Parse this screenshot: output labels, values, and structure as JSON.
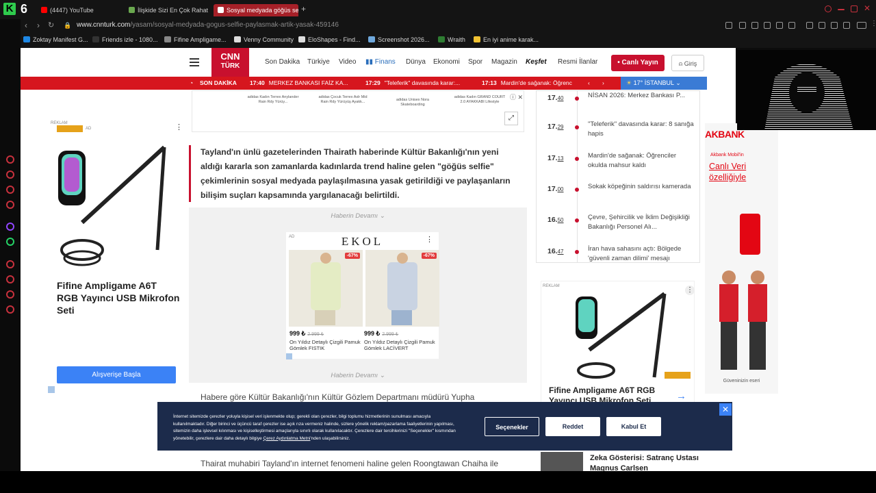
{
  "browser": {
    "tabs": [
      {
        "label": "(4447) YouTube",
        "color": "#ff0000"
      },
      {
        "label": "İlişkide Sizi En Çok Rahatsı",
        "color": "#6aa84f"
      },
      {
        "label": "Sosyal medyada göğüs se",
        "color": "#e06666"
      }
    ],
    "url_host": "www.cnnturk.com",
    "url_path": "/yasam/sosyal-medyada-gogus-selfie-paylasmak-artik-yasak-459146",
    "bookmarks": [
      "Zoktay Manifest G...",
      "Friends izle - 1080...",
      "Fifine Ampligame...",
      "Venny Community",
      "EloShapes - Find...",
      "Screenshot 2026...",
      "Wraith",
      "En iyi anime karak..."
    ]
  },
  "header": {
    "logo_line1": "CNN",
    "logo_line2": "TÜRK",
    "nav": [
      "Son Dakika",
      "Türkiye",
      "Video",
      "Finans",
      "Dünya",
      "Ekonomi",
      "Spor",
      "Magazin",
      "Keşfet",
      "Resmi İlanlar"
    ],
    "live_label": "Canlı Yayın",
    "login_label": "Giriş"
  },
  "ticker": {
    "label": "SON DAKİKA",
    "items": [
      {
        "time": "17:40",
        "text": "MERKEZ BANKASI FAİZ KA..."
      },
      {
        "time": "17:29",
        "text": "\"Teleferik\" davasında karar:..."
      },
      {
        "time": "17:13",
        "text": "Mardin'de sağanak: Öğrenc"
      }
    ],
    "weather": "17° İSTANBUL"
  },
  "top_ads": [
    "adidas Kadın Terrex Anylander Rain Rdy Yürüy...",
    "adidas Çocuk Terrex Axlr Mid Rain Rdy Yürüyüş Ayakk...",
    "adidas Unisex Nora Skateboarding",
    "adidas Kadın GRAND COURT 2.0 AYAKKABI Lifestyle"
  ],
  "article": {
    "lead": "Tayland'ın ünlü gazetelerinden Thairath haberinde Kültür Bakanlığı'nın yeni aldığı kararla son zamanlarda kadınlarda trend haline gelen \"göğüs selfie\" çekimlerinin sosyal medyada paylaşılmasına yasak getirildiği ve paylaşanların bilişim suçları kapsamında yargılanacağı belirtildi.",
    "continue": "Haberin Devamı",
    "para1": "Habere göre Kültür Bakanlığı'nın Kültür Gözlem Departmanı müdürü Yupha",
    "para2": "Thairat muhabiri Tayland'ın internet fenomeni haline gelen Roongtawan Chaiha ile"
  },
  "ekol_ad": {
    "brand": "EKOL",
    "ad_tag": "AD",
    "products": [
      {
        "discount": "-67%",
        "price": "999 ₺",
        "old": "2.999 ₺",
        "name": "On Yıldız Detaylı Çizgili Pamuk Gömlek FISTIK"
      },
      {
        "discount": "-67%",
        "price": "999 ₺",
        "old": "2.999 ₺",
        "name": "On Yıldız Detaylı Çizgili Pamuk Gömlek LACİVERT"
      }
    ]
  },
  "left_ad": {
    "title": "Fifine Ampligame A6T RGB Yayıncı USB Mikrofon Seti",
    "button": "Alışverişe Başla",
    "tag": "AD",
    "reklam": "REKLAM"
  },
  "news_list": [
    {
      "hour": "17.",
      "min": "40",
      "title": "NİSAN 2026: Merkez Bankası P..."
    },
    {
      "hour": "17.",
      "min": "29",
      "title": "\"Teleferik\" davasında karar: 8 sanığa hapis"
    },
    {
      "hour": "17.",
      "min": "13",
      "title": "Mardin'de sağanak: Öğrenciler okulda mahsur kaldı"
    },
    {
      "hour": "17.",
      "min": "00",
      "title": "Sokak köpeğinin saldırısı kamerada"
    },
    {
      "hour": "16.",
      "min": "50",
      "title": "Çevre, Şehircilik ve İklim Değişikliği Bakanlığı Personel Alı..."
    },
    {
      "hour": "16.",
      "min": "47",
      "title": "İran hava sahasını açtı: Bölgede 'güvenli zaman dilimi' mesajı"
    }
  ],
  "right_ad": {
    "title": "Fifine Ampligame A6T RGB Yayıncı USB Mikrofon Seti",
    "reklam": "REKLAM"
  },
  "zeka_title": "Zeka Gösterisi: Satranç Ustası Magnus Carlsen",
  "akbank": {
    "logo": "AKBANK",
    "sub": "Akbank Mobil'in",
    "big1": "Canlı Veri",
    "big2": "özelliğiyle",
    "foot": "Güveninizin eseri"
  },
  "cookie": {
    "text": "İnternet sitemizde çerezler yoluyla kişisel veri işlenmekte olup; gerekli olan çerezler, bilgi toplumu hizmetlerinin sunulması amacıyla kullanılmaktadır. Diğer birinci ve üçüncü taraf çerezler ise açık rıza vermeniz halinde, sizlere yönelik reklam/pazarlama faaliyetlerinin yapılması, sitemizin daha işlevsel kılınması ve kişiselleştirmesi amaçlarıyla sınırlı olarak kullanılacaktır. Çerezlere dair tercihlerinizi \"Seçenekler\" kısmından yönetebilir, çerezlere dair daha detaylı bilgiye ",
    "link": "Çerez Aydınlatma Metni",
    "text_end": "'nden ulaşabilirsiniz.",
    "options": "Seçenekler",
    "reject": "Reddet",
    "accept": "Kabul Et"
  },
  "colors": {
    "brand": "#c8102e",
    "cookie_bg": "#1c2b4b",
    "cta_blue": "#3b82f6"
  }
}
